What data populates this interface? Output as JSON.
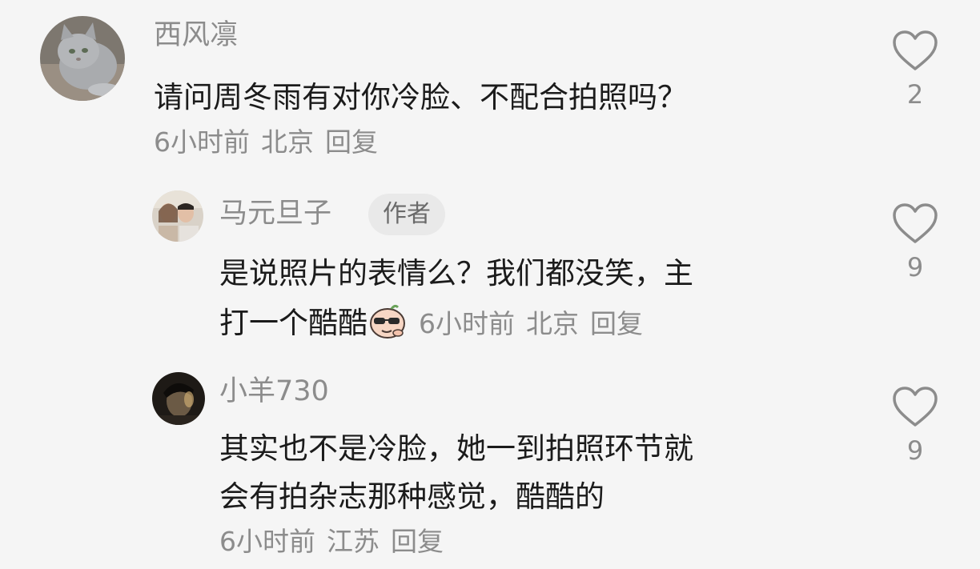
{
  "comments": [
    {
      "username": "西风凛",
      "text_lines": [
        "请问周冬雨有对你冷脸、不配合拍照吗？"
      ],
      "time": "6小时前",
      "location": "北京",
      "reply_label": "回复",
      "likes": "2"
    },
    {
      "username": "马元旦子",
      "badge": "作者",
      "text_lines": [
        "是说照片的表情么？我们都没笑，主",
        "打一个酷酷"
      ],
      "emoji": "cool-sunglasses-emoji",
      "time": "6小时前",
      "location": "北京",
      "reply_label": "回复",
      "likes": "9"
    },
    {
      "username": "小羊730",
      "text_lines": [
        "其实也不是冷脸，她一到拍照环节就",
        "会有拍杂志那种感觉，酷酷的"
      ],
      "time": "6小时前",
      "location": "江苏",
      "reply_label": "回复",
      "likes": "9"
    }
  ],
  "icons": {
    "like": "heart-outline-icon"
  },
  "colors": {
    "background": "#f5f5f5",
    "text": "#1b1b1b",
    "muted": "#8c8c8c",
    "badge_bg": "#e9e9e9"
  }
}
